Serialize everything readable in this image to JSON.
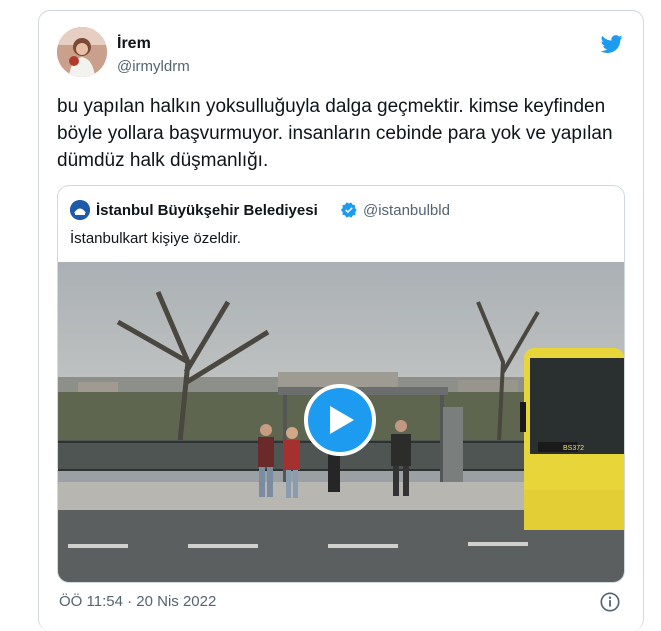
{
  "author": {
    "name": "İrem",
    "handle": "@irmyldrm",
    "avatar_icon": "profile-photo"
  },
  "tweet": {
    "text": "bu yapılan halkın yoksulluğuyla dalga geçmektir. kimse keyfinden böyle yollara başvurmuyor. insanların cebinde para yok ve yapılan dümdüz halk düşmanlığı.",
    "timestamp": "ÖÖ 11:54 · 20 Nis 2022"
  },
  "quote": {
    "name": "İstanbul Büyükşehir Belediyesi",
    "handle": "@istanbulbld",
    "text": "İstanbulkart kişiye özeldir.",
    "verified": true
  },
  "media": {
    "type": "video",
    "bus_route": "BS372"
  },
  "colors": {
    "twitter_blue": "#1d9bf0",
    "text_primary": "#0f1419",
    "text_secondary": "#536471",
    "border": "#cfd9de",
    "bus_yellow": "#e8d53a"
  },
  "icons": {
    "brand": "twitter-bird-icon",
    "verified": "verified-badge-icon",
    "play": "play-icon",
    "info": "info-icon"
  }
}
